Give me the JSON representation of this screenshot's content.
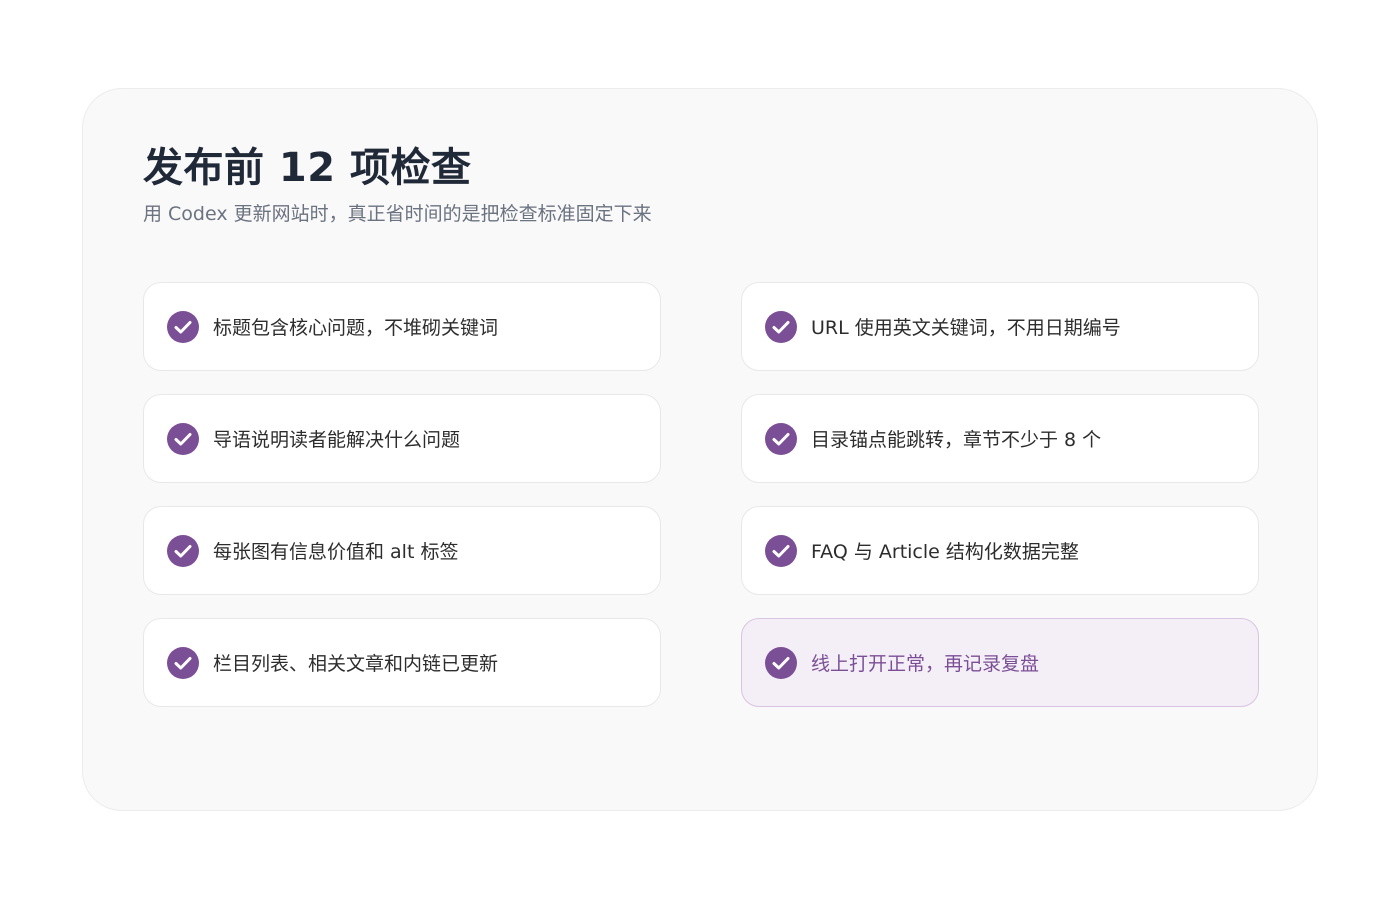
{
  "header": {
    "title": "发布前 12 项检查",
    "subtitle": "用 Codex 更新网站时，真正省时间的是把检查标准固定下来"
  },
  "colors": {
    "accent": "#7b4f96",
    "highlight_bg": "#f4eef7"
  },
  "checklist": {
    "icon": "check-circle-icon",
    "items": [
      {
        "label": "标题包含核心问题，不堆砌关键词"
      },
      {
        "label": "URL 使用英文关键词，不用日期编号"
      },
      {
        "label": "导语说明读者能解决什么问题"
      },
      {
        "label": "目录锚点能跳转，章节不少于 8 个"
      },
      {
        "label": "每张图有信息价值和 alt 标签"
      },
      {
        "label": "FAQ 与 Article 结构化数据完整"
      },
      {
        "label": "栏目列表、相关文章和内链已更新"
      },
      {
        "label": "线上打开正常，再记录复盘"
      }
    ]
  }
}
